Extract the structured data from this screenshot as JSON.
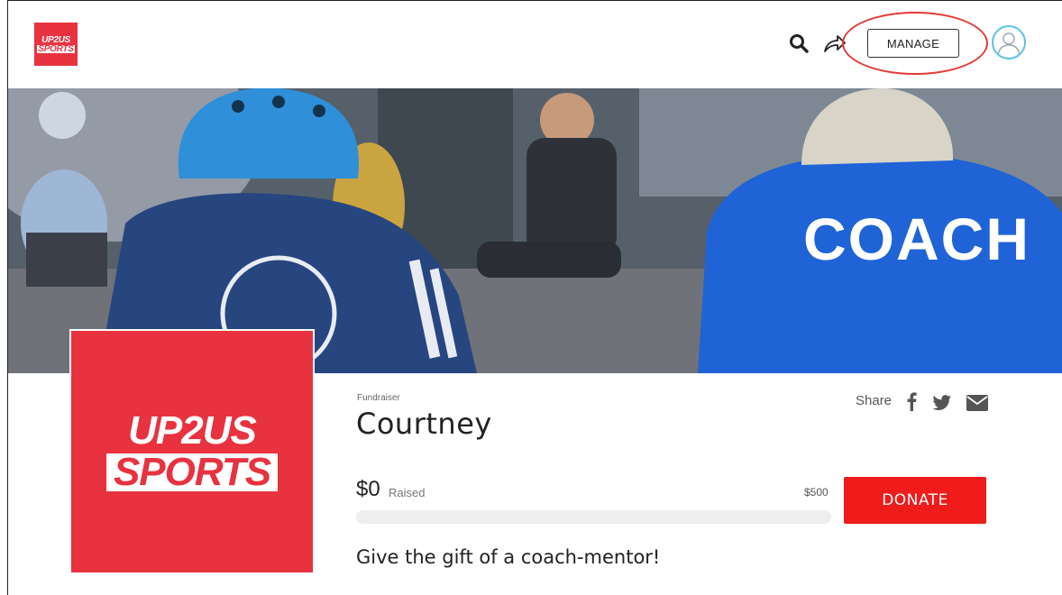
{
  "header": {
    "logo": {
      "line1": "UP2US",
      "line2": "SPORTS"
    },
    "manage_label": "MANAGE",
    "icons": {
      "search": "search-icon",
      "share": "share-arrow-icon",
      "avatar": "user-avatar-icon"
    }
  },
  "banner": {
    "shirt_text": "COACH",
    "colors": {
      "helmet": "#2f8fd8",
      "shirt_left": "#27457f",
      "shirt_right": "#1f63d6"
    }
  },
  "profile_logo": {
    "line1": "UP2US",
    "line2": "SPORTS",
    "color": "#e8323f"
  },
  "fundraiser": {
    "label": "Fundraiser",
    "name": "Courtney",
    "share_label": "Share",
    "raised_amount": "$0",
    "raised_label": "Raised",
    "goal": "$500",
    "progress_fraction": 0,
    "donate_label": "DONATE",
    "tagline": "Give the gift of a coach-mentor!"
  },
  "colors": {
    "brand_red": "#e8323f",
    "donate_red": "#f01b1b",
    "highlight": "#e53935",
    "avatar_ring": "#5bc0eb"
  }
}
